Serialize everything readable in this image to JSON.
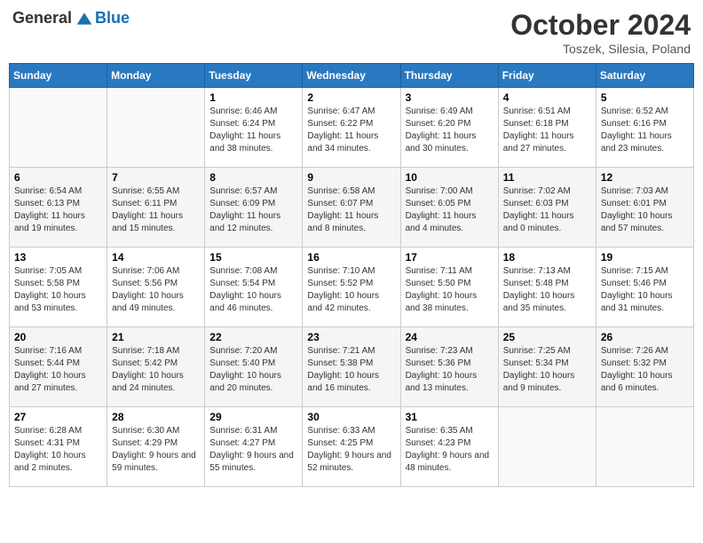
{
  "header": {
    "logo_general": "General",
    "logo_blue": "Blue",
    "month": "October 2024",
    "location": "Toszek, Silesia, Poland"
  },
  "days_of_week": [
    "Sunday",
    "Monday",
    "Tuesday",
    "Wednesday",
    "Thursday",
    "Friday",
    "Saturday"
  ],
  "weeks": [
    [
      {
        "day": "",
        "detail": ""
      },
      {
        "day": "",
        "detail": ""
      },
      {
        "day": "1",
        "detail": "Sunrise: 6:46 AM\nSunset: 6:24 PM\nDaylight: 11 hours and 38 minutes."
      },
      {
        "day": "2",
        "detail": "Sunrise: 6:47 AM\nSunset: 6:22 PM\nDaylight: 11 hours and 34 minutes."
      },
      {
        "day": "3",
        "detail": "Sunrise: 6:49 AM\nSunset: 6:20 PM\nDaylight: 11 hours and 30 minutes."
      },
      {
        "day": "4",
        "detail": "Sunrise: 6:51 AM\nSunset: 6:18 PM\nDaylight: 11 hours and 27 minutes."
      },
      {
        "day": "5",
        "detail": "Sunrise: 6:52 AM\nSunset: 6:16 PM\nDaylight: 11 hours and 23 minutes."
      }
    ],
    [
      {
        "day": "6",
        "detail": "Sunrise: 6:54 AM\nSunset: 6:13 PM\nDaylight: 11 hours and 19 minutes."
      },
      {
        "day": "7",
        "detail": "Sunrise: 6:55 AM\nSunset: 6:11 PM\nDaylight: 11 hours and 15 minutes."
      },
      {
        "day": "8",
        "detail": "Sunrise: 6:57 AM\nSunset: 6:09 PM\nDaylight: 11 hours and 12 minutes."
      },
      {
        "day": "9",
        "detail": "Sunrise: 6:58 AM\nSunset: 6:07 PM\nDaylight: 11 hours and 8 minutes."
      },
      {
        "day": "10",
        "detail": "Sunrise: 7:00 AM\nSunset: 6:05 PM\nDaylight: 11 hours and 4 minutes."
      },
      {
        "day": "11",
        "detail": "Sunrise: 7:02 AM\nSunset: 6:03 PM\nDaylight: 11 hours and 0 minutes."
      },
      {
        "day": "12",
        "detail": "Sunrise: 7:03 AM\nSunset: 6:01 PM\nDaylight: 10 hours and 57 minutes."
      }
    ],
    [
      {
        "day": "13",
        "detail": "Sunrise: 7:05 AM\nSunset: 5:58 PM\nDaylight: 10 hours and 53 minutes."
      },
      {
        "day": "14",
        "detail": "Sunrise: 7:06 AM\nSunset: 5:56 PM\nDaylight: 10 hours and 49 minutes."
      },
      {
        "day": "15",
        "detail": "Sunrise: 7:08 AM\nSunset: 5:54 PM\nDaylight: 10 hours and 46 minutes."
      },
      {
        "day": "16",
        "detail": "Sunrise: 7:10 AM\nSunset: 5:52 PM\nDaylight: 10 hours and 42 minutes."
      },
      {
        "day": "17",
        "detail": "Sunrise: 7:11 AM\nSunset: 5:50 PM\nDaylight: 10 hours and 38 minutes."
      },
      {
        "day": "18",
        "detail": "Sunrise: 7:13 AM\nSunset: 5:48 PM\nDaylight: 10 hours and 35 minutes."
      },
      {
        "day": "19",
        "detail": "Sunrise: 7:15 AM\nSunset: 5:46 PM\nDaylight: 10 hours and 31 minutes."
      }
    ],
    [
      {
        "day": "20",
        "detail": "Sunrise: 7:16 AM\nSunset: 5:44 PM\nDaylight: 10 hours and 27 minutes."
      },
      {
        "day": "21",
        "detail": "Sunrise: 7:18 AM\nSunset: 5:42 PM\nDaylight: 10 hours and 24 minutes."
      },
      {
        "day": "22",
        "detail": "Sunrise: 7:20 AM\nSunset: 5:40 PM\nDaylight: 10 hours and 20 minutes."
      },
      {
        "day": "23",
        "detail": "Sunrise: 7:21 AM\nSunset: 5:38 PM\nDaylight: 10 hours and 16 minutes."
      },
      {
        "day": "24",
        "detail": "Sunrise: 7:23 AM\nSunset: 5:36 PM\nDaylight: 10 hours and 13 minutes."
      },
      {
        "day": "25",
        "detail": "Sunrise: 7:25 AM\nSunset: 5:34 PM\nDaylight: 10 hours and 9 minutes."
      },
      {
        "day": "26",
        "detail": "Sunrise: 7:26 AM\nSunset: 5:32 PM\nDaylight: 10 hours and 6 minutes."
      }
    ],
    [
      {
        "day": "27",
        "detail": "Sunrise: 6:28 AM\nSunset: 4:31 PM\nDaylight: 10 hours and 2 minutes."
      },
      {
        "day": "28",
        "detail": "Sunrise: 6:30 AM\nSunset: 4:29 PM\nDaylight: 9 hours and 59 minutes."
      },
      {
        "day": "29",
        "detail": "Sunrise: 6:31 AM\nSunset: 4:27 PM\nDaylight: 9 hours and 55 minutes."
      },
      {
        "day": "30",
        "detail": "Sunrise: 6:33 AM\nSunset: 4:25 PM\nDaylight: 9 hours and 52 minutes."
      },
      {
        "day": "31",
        "detail": "Sunrise: 6:35 AM\nSunset: 4:23 PM\nDaylight: 9 hours and 48 minutes."
      },
      {
        "day": "",
        "detail": ""
      },
      {
        "day": "",
        "detail": ""
      }
    ]
  ]
}
